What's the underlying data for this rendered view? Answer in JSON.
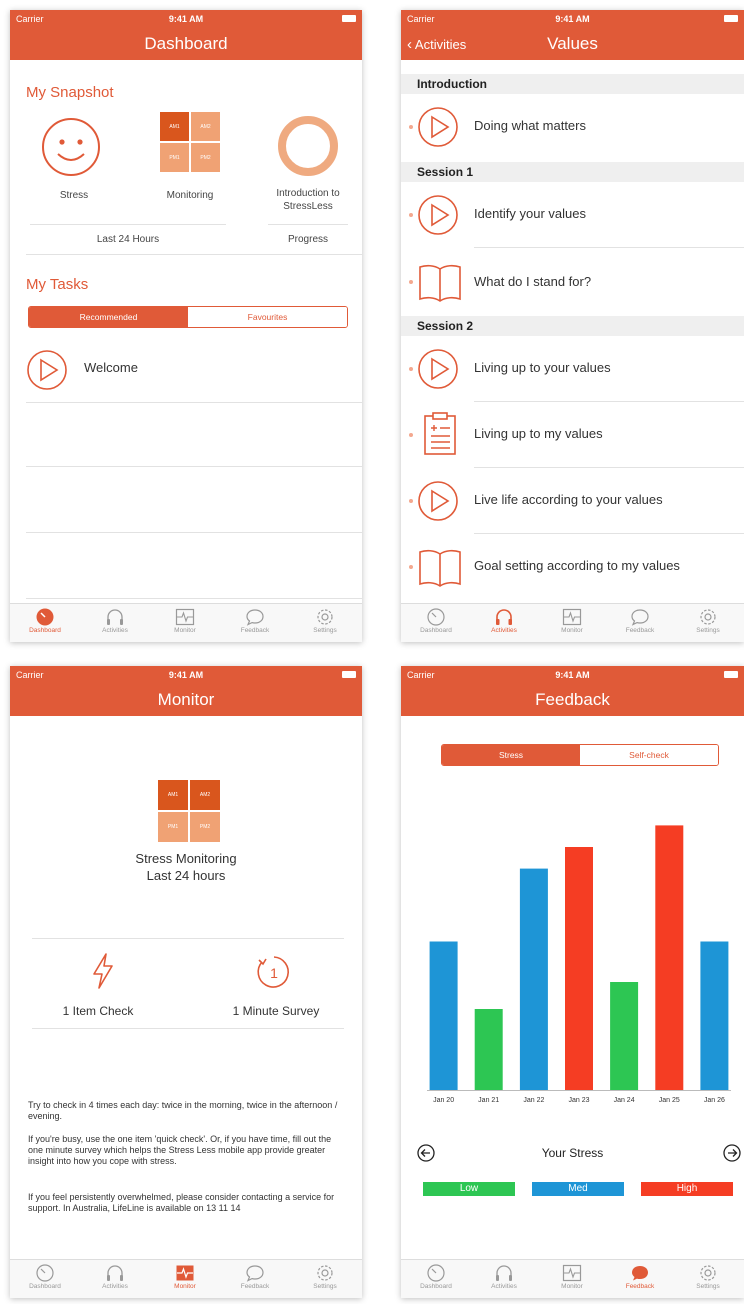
{
  "status": {
    "carrier": "Carrier",
    "time": "9:41 AM"
  },
  "tabs": [
    {
      "label": "Dashboard",
      "icon": "speedometer-icon"
    },
    {
      "label": "Activities",
      "icon": "headphones-icon"
    },
    {
      "label": "Monitor",
      "icon": "heartbeat-icon"
    },
    {
      "label": "Feedback",
      "icon": "speech-bubble-icon"
    },
    {
      "label": "Settings",
      "icon": "gear-icon"
    }
  ],
  "colors": {
    "accent": "#E05A38",
    "low": "#2DC653",
    "med": "#1E95D6",
    "high": "#F53D23"
  },
  "dashboard": {
    "title": "Dashboard",
    "snapshot_title": "My Snapshot",
    "stress_label": "Stress",
    "monitoring_label": "Monitoring",
    "intro_label_1": "Introduction to",
    "intro_label_2": "StressLess",
    "last24_label": "Last 24 Hours",
    "progress_label": "Progress",
    "grid": [
      "AM1",
      "AM2",
      "PM1",
      "PM2"
    ],
    "tasks_title": "My Tasks",
    "seg_recommended": "Recommended",
    "seg_favourites": "Favourites",
    "task_welcome": "Welcome"
  },
  "values": {
    "back_label": "Activities",
    "title": "Values",
    "sections": [
      {
        "header": "Introduction",
        "items": [
          {
            "label": "Doing what matters",
            "icon": "play-circle-icon"
          }
        ]
      },
      {
        "header": "Session 1",
        "items": [
          {
            "label": "Identify your values",
            "icon": "play-circle-icon"
          },
          {
            "label": "What do I stand for?",
            "icon": "book-icon"
          }
        ]
      },
      {
        "header": "Session 2",
        "items": [
          {
            "label": "Living up to your values",
            "icon": "play-circle-icon"
          },
          {
            "label": "Living up to my values",
            "icon": "clipboard-icon"
          },
          {
            "label": "Live life according to your values",
            "icon": "play-circle-icon"
          },
          {
            "label": "Goal setting according to my values",
            "icon": "book-icon"
          }
        ]
      }
    ]
  },
  "monitor": {
    "title": "Monitor",
    "grid": [
      "AM1",
      "AM2",
      "PM1",
      "PM2"
    ],
    "heading_1": "Stress Monitoring",
    "heading_2": "Last 24 hours",
    "item_check": "1 Item Check",
    "minute_survey": "1 Minute Survey",
    "survey_icon_text": "1",
    "para_1": "Try to check in 4 times each day: twice in the morning, twice in the afternoon / evening.",
    "para_2": "If you're busy, use the one item 'quick check'. Or, if you have time, fill out the one minute survey which helps the Stress Less mobile app provide greater insight into how you cope with stress.",
    "para_3": "If you feel persistently overwhelmed, please consider contacting a service for support. In Australia, LifeLine is available on 13 11 14"
  },
  "feedback": {
    "title": "Feedback",
    "seg_stress": "Stress",
    "seg_selfcheck": "Self-check",
    "nav_label": "Your Stress",
    "legend": [
      "Low",
      "Med",
      "High"
    ]
  },
  "chart_data": {
    "type": "bar",
    "categories": [
      "Jan 20",
      "Jan 21",
      "Jan 22",
      "Jan 23",
      "Jan 24",
      "Jan 25",
      "Jan 26"
    ],
    "values": [
      5.5,
      3.0,
      8.2,
      9.0,
      4.0,
      9.8,
      5.5
    ],
    "levels": [
      "Med",
      "Low",
      "Med",
      "High",
      "Low",
      "High",
      "Med"
    ],
    "ylim": [
      0,
      10
    ],
    "grid": false,
    "legend_placement": "bottom"
  }
}
